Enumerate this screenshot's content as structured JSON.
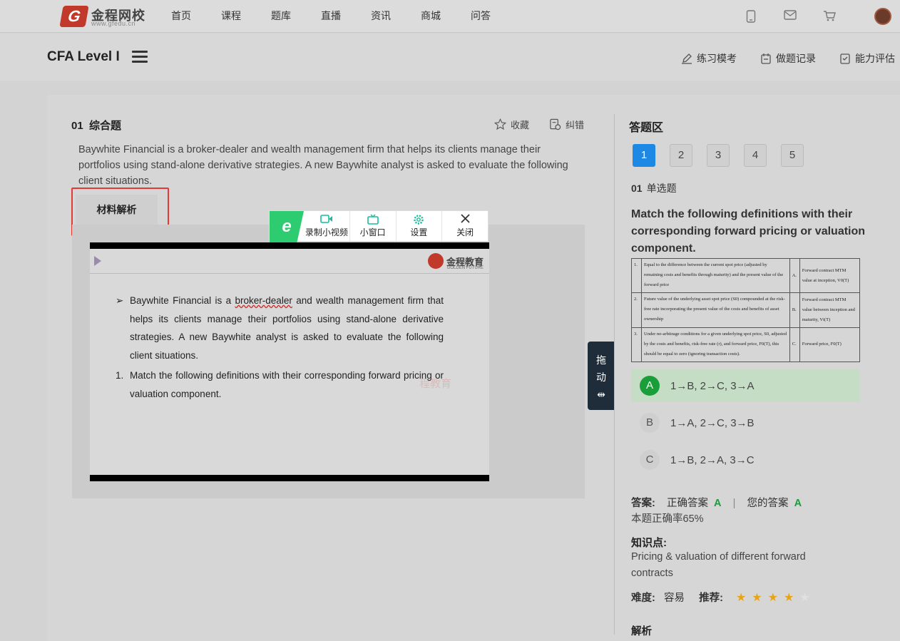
{
  "topnav": {
    "logo_mark": "G",
    "logo_name": "金程网校",
    "logo_url": "www.gfedu.cn",
    "links": [
      "首页",
      "课程",
      "题库",
      "直播",
      "资讯",
      "商城",
      "问答"
    ]
  },
  "subheader": {
    "title": "CFA Level I",
    "actions": [
      "练习模考",
      "做题记录",
      "能力评估"
    ]
  },
  "question": {
    "number": "01",
    "type_label": "综合题",
    "favorite": "收藏",
    "report": "纠错",
    "stem": "Baywhite Financial is a broker-dealer and wealth management firm that helps its clients manage their portfolios using stand-alone derivative strategies. A new Baywhite analyst is asked to evaluate the following client situations.",
    "material_tab": "材料解析"
  },
  "toolbar": {
    "logo": "e",
    "items": [
      {
        "icon": "video-icon",
        "label": "录制小视频"
      },
      {
        "icon": "tv-icon",
        "label": "小窗口"
      },
      {
        "icon": "gear-icon",
        "label": "设置"
      },
      {
        "icon": "close-icon",
        "label": "关闭"
      }
    ]
  },
  "video": {
    "brand": "金程教育",
    "brand_sub": "GOLDEN FUTURE",
    "bullet_pre": "Baywhite Financial is a ",
    "bullet_underlined": "broker-dealer",
    "bullet_post": " and wealth management firm that helps its clients manage their portfolios using stand-alone derivative strategies. A new Baywhite analyst is asked to evaluate the following client situations.",
    "item_number": "1.",
    "item_text": "Match the following definitions with their corresponding forward pricing or valuation component.",
    "watermark": "程教育"
  },
  "drag": {
    "line1": "拖",
    "line2": "动",
    "arrow": "⇹"
  },
  "answer_area": {
    "title": "答题区",
    "numbers": [
      "1",
      "2",
      "3",
      "4",
      "5"
    ],
    "active": "1",
    "sub_number": "01",
    "sub_type": "单选题",
    "question_text": "Match the following definitions with their corresponding forward pricing or valuation component.",
    "table": [
      {
        "n": "1.",
        "def": "Equal to the difference between the current spot price (adjusted by remaining costs and benefits through maturity) and the present value of the forward price",
        "l": "A.",
        "comp": "Forward contract MTM value at inception, V0(T)"
      },
      {
        "n": "2.",
        "def": "Future value of the underlying asset spot price (S0) compounded at the risk-free rate incorporating the present value of the costs and benefits of asset ownership",
        "l": "B.",
        "comp": "Forward contract MTM value between inception and maturity, Vt(T)"
      },
      {
        "n": "3.",
        "def": "Under no-arbitrage conditions for a given underlying spot price, S0, adjusted by the costs and benefits, risk-free rate (r), and forward price, F0(T), this should be equal to zero (ignoring transaction costs).",
        "l": "C.",
        "comp": "Forward price, F0(T)"
      }
    ],
    "options": [
      {
        "letter": "A",
        "text": "1→B, 2→C, 3→A"
      },
      {
        "letter": "B",
        "text": "1→A, 2→C, 3→B"
      },
      {
        "letter": "C",
        "text": "1→B, 2→A, 3→C"
      }
    ],
    "answer_label": "答案:",
    "correct_label": "正确答案",
    "correct_value": "A",
    "separator": "|",
    "your_label": "您的答案",
    "your_value": "A",
    "rate_text": "本题正确率65%",
    "kp_label": "知识点:",
    "kp_value": "Pricing & valuation of different forward contracts",
    "difficulty_label": "难度:",
    "difficulty_value": "容易",
    "recommend_label": "推荐:",
    "recommend_stars": 4,
    "recommend_max": 5,
    "analysis_label": "解析"
  }
}
